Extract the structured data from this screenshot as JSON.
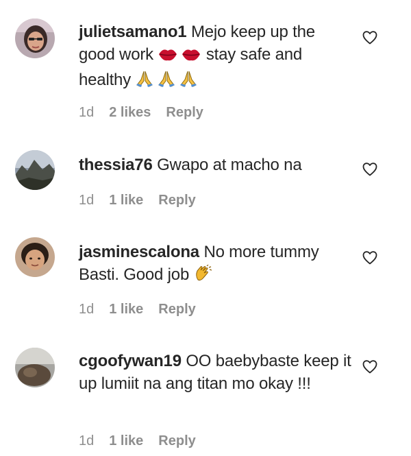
{
  "comments": [
    {
      "username": "julietsamano1",
      "text_parts": [
        "Mejo keep up the good work ",
        " stay safe and healthy "
      ],
      "age": "1d",
      "likes": "2 likes",
      "reply": "Reply",
      "emojis": [
        "lips-icon",
        "lips-icon",
        "folded-hands-icon",
        "folded-hands-icon",
        "folded-hands-icon"
      ]
    },
    {
      "username": "thessia76",
      "text": "Gwapo at macho na",
      "age": "1d",
      "likes": "1 like",
      "reply": "Reply"
    },
    {
      "username": "jasminescalona",
      "text": "No more tummy Basti. Good job ",
      "age": "1d",
      "likes": "1 like",
      "reply": "Reply",
      "emojis": [
        "clapping-hands-icon"
      ]
    },
    {
      "username": "cgoofywan19",
      "text": "OO baebybaste keep it up lumiit na ang titan mo okay !!!",
      "age": "1d",
      "likes": "1 like",
      "reply": "Reply"
    }
  ],
  "colors": {
    "text": "#262626",
    "meta": "#8e8e8e",
    "heart_outline": "#262626"
  }
}
